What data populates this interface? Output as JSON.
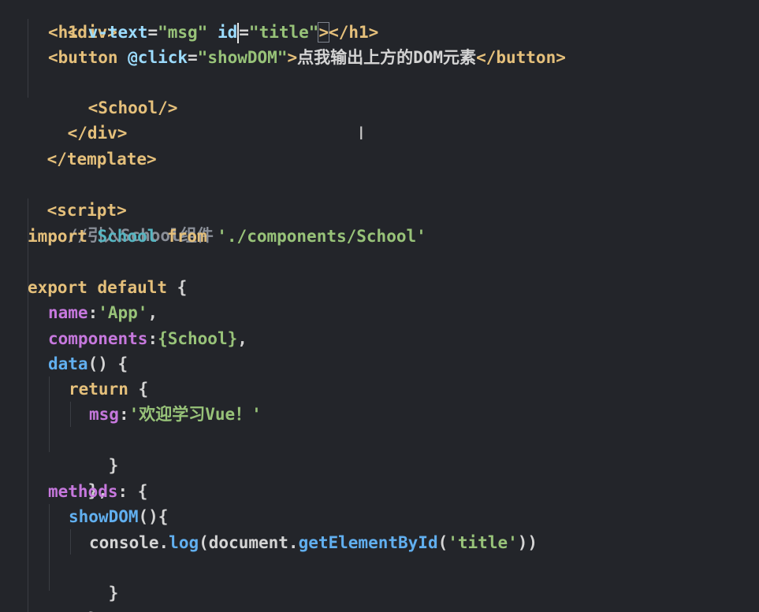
{
  "lines": [
    {
      "parts": [
        "<div>"
      ]
    },
    {
      "parts": [
        "<h1 ",
        "v-text",
        "=",
        "\"msg\"",
        " ",
        "id",
        "=",
        "\"title\"",
        ">",
        "</h1>"
      ]
    },
    {
      "parts": [
        "<button ",
        "@click",
        "=",
        "\"showDOM\"",
        ">",
        "点我输出上方的DOM元素",
        "</button>"
      ]
    },
    {
      "parts": [
        "<School/>"
      ]
    },
    {
      "parts": [
        "</div>"
      ]
    },
    {
      "parts": [
        "</template>"
      ]
    },
    {
      "parts": [
        ""
      ]
    },
    {
      "parts": [
        "<script>"
      ]
    },
    {
      "parts": [
        "//引入School组件"
      ]
    },
    {
      "parts": [
        "import",
        " ",
        "School",
        " ",
        "from",
        " ",
        "'./components/School'"
      ]
    },
    {
      "parts": [
        ""
      ]
    },
    {
      "parts": [
        "export",
        " ",
        "default",
        " {"
      ]
    },
    {
      "parts": [
        "name",
        ":",
        "'App'",
        ","
      ]
    },
    {
      "parts": [
        "components",
        ":",
        "{School}",
        ","
      ]
    },
    {
      "parts": [
        "data",
        "() {"
      ]
    },
    {
      "parts": [
        "return",
        " {"
      ]
    },
    {
      "parts": [
        "msg",
        ":",
        "'欢迎学习Vue！'"
      ]
    },
    {
      "parts": [
        "}"
      ]
    },
    {
      "parts": [
        "},"
      ]
    },
    {
      "parts": [
        "methods",
        ": {"
      ]
    },
    {
      "parts": [
        "showDOM",
        "(){"
      ]
    },
    {
      "parts": [
        "console",
        ".",
        "log",
        "(",
        "document",
        ".",
        "getElementById",
        "(",
        "'title'",
        "))"
      ]
    },
    {
      "parts": [
        "}"
      ]
    },
    {
      "parts": [
        "},"
      ]
    }
  ],
  "cursor_icon": "text-cursor-icon"
}
